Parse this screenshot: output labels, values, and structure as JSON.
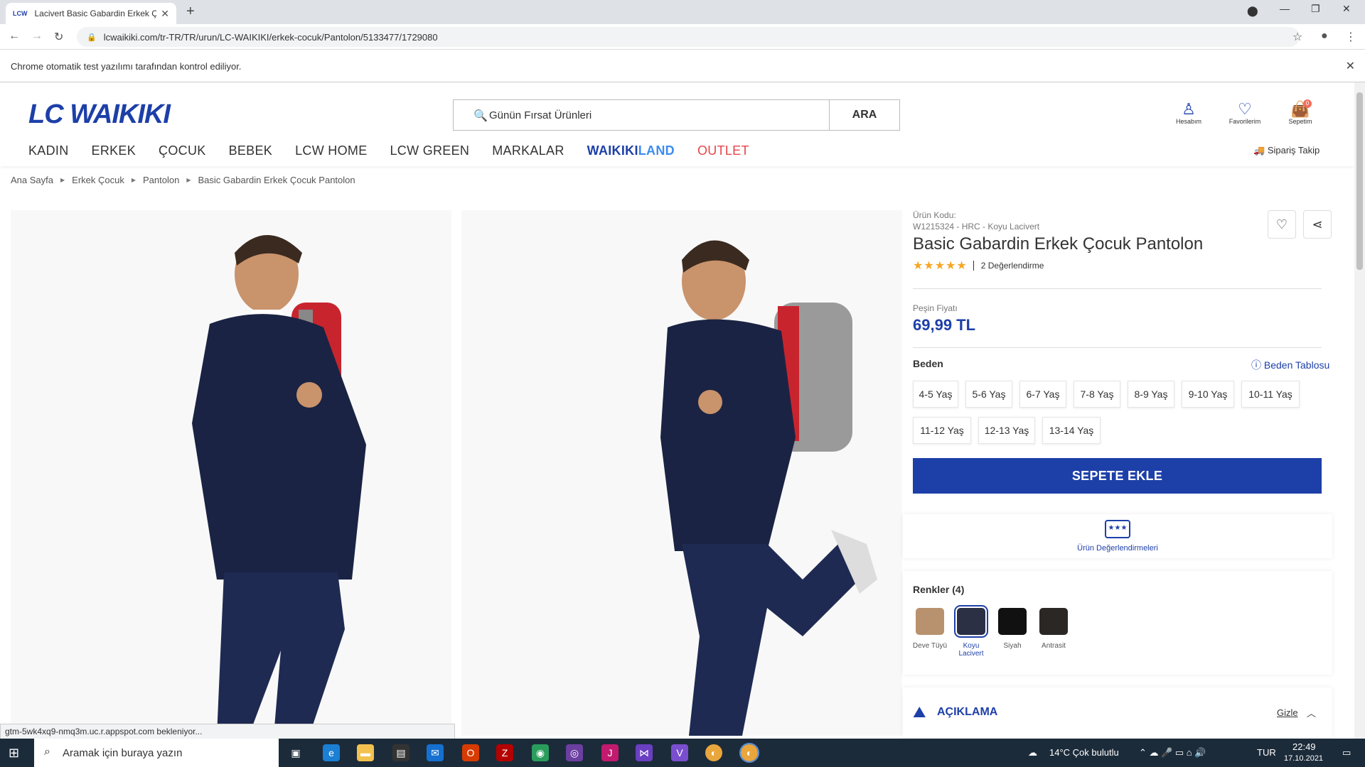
{
  "browser": {
    "tab_title": "Lacivert Basic Gabardin Erkek Ço",
    "tab_favicon": "LCW",
    "url": "lcwaikiki.com/tr-TR/TR/urun/LC-WAIKIKI/erkek-cocuk/Pantolon/5133477/1729080",
    "infobar_text": "Chrome otomatik test yazılımı tarafından kontrol ediliyor.",
    "status_text": "gtm-5wk4xq9-nmq3m.uc.r.appspot.com bekleniyor..."
  },
  "site": {
    "logo": "LC WAIKIKI",
    "search_placeholder": "Günün Fırsat Ürünleri",
    "search_button": "ARA",
    "header_icons": [
      {
        "label": "Hesabım",
        "icon": "user-icon"
      },
      {
        "label": "Favorilerim",
        "icon": "heart-icon"
      },
      {
        "label": "Sepetim",
        "icon": "bag-icon",
        "badge": "0"
      }
    ],
    "nav": [
      "KADIN",
      "ERKEK",
      "ÇOCUK",
      "BEBEK",
      "LCW HOME",
      "LCW GREEN",
      "MARKALAR"
    ],
    "nav_waikiki": "WAIKIKI",
    "nav_land": "LAND",
    "nav_outlet": "OUTLET",
    "order_track": "Sipariş Takip",
    "breadcrumbs": [
      "Ana Sayfa",
      "Erkek Çocuk",
      "Pantolon",
      "Basic Gabardin Erkek Çocuk Pantolon"
    ]
  },
  "product": {
    "code_label": "Ürün Kodu:",
    "code": "W1215324 - HRC - Koyu Lacivert",
    "title": "Basic Gabardin Erkek Çocuk Pantolon",
    "rating": 5,
    "reviews": "2 Değerlendirme",
    "price_label": "Peşin Fiyatı",
    "price": "69,99 TL",
    "size_label": "Beden",
    "size_table": "Beden Tablosu",
    "sizes": [
      "4-5 Yaş",
      "5-6 Yaş",
      "6-7 Yaş",
      "7-8 Yaş",
      "8-9 Yaş",
      "9-10 Yaş",
      "10-11 Yaş",
      "11-12 Yaş",
      "12-13 Yaş",
      "13-14 Yaş"
    ],
    "add_to_cart": "SEPETE EKLE",
    "reviews_panel": "Ürün Değerlendirmeleri",
    "colors_label": "Renkler (4)",
    "colors": [
      {
        "name": "Deve Tüyü",
        "hex": "#b8926e"
      },
      {
        "name": "Koyu Lacivert",
        "hex": "#2b3045",
        "selected": true
      },
      {
        "name": "Siyah",
        "hex": "#111111"
      },
      {
        "name": "Antrasit",
        "hex": "#2a2724"
      }
    ],
    "description": "AÇIKLAMA",
    "hide": "Gizle"
  },
  "taskbar": {
    "search_placeholder": "Aramak için buraya yazın",
    "weather": "14°C  Çok bulutlu",
    "lang": "TUR",
    "time": "22:49",
    "date": "17.10.2021"
  }
}
